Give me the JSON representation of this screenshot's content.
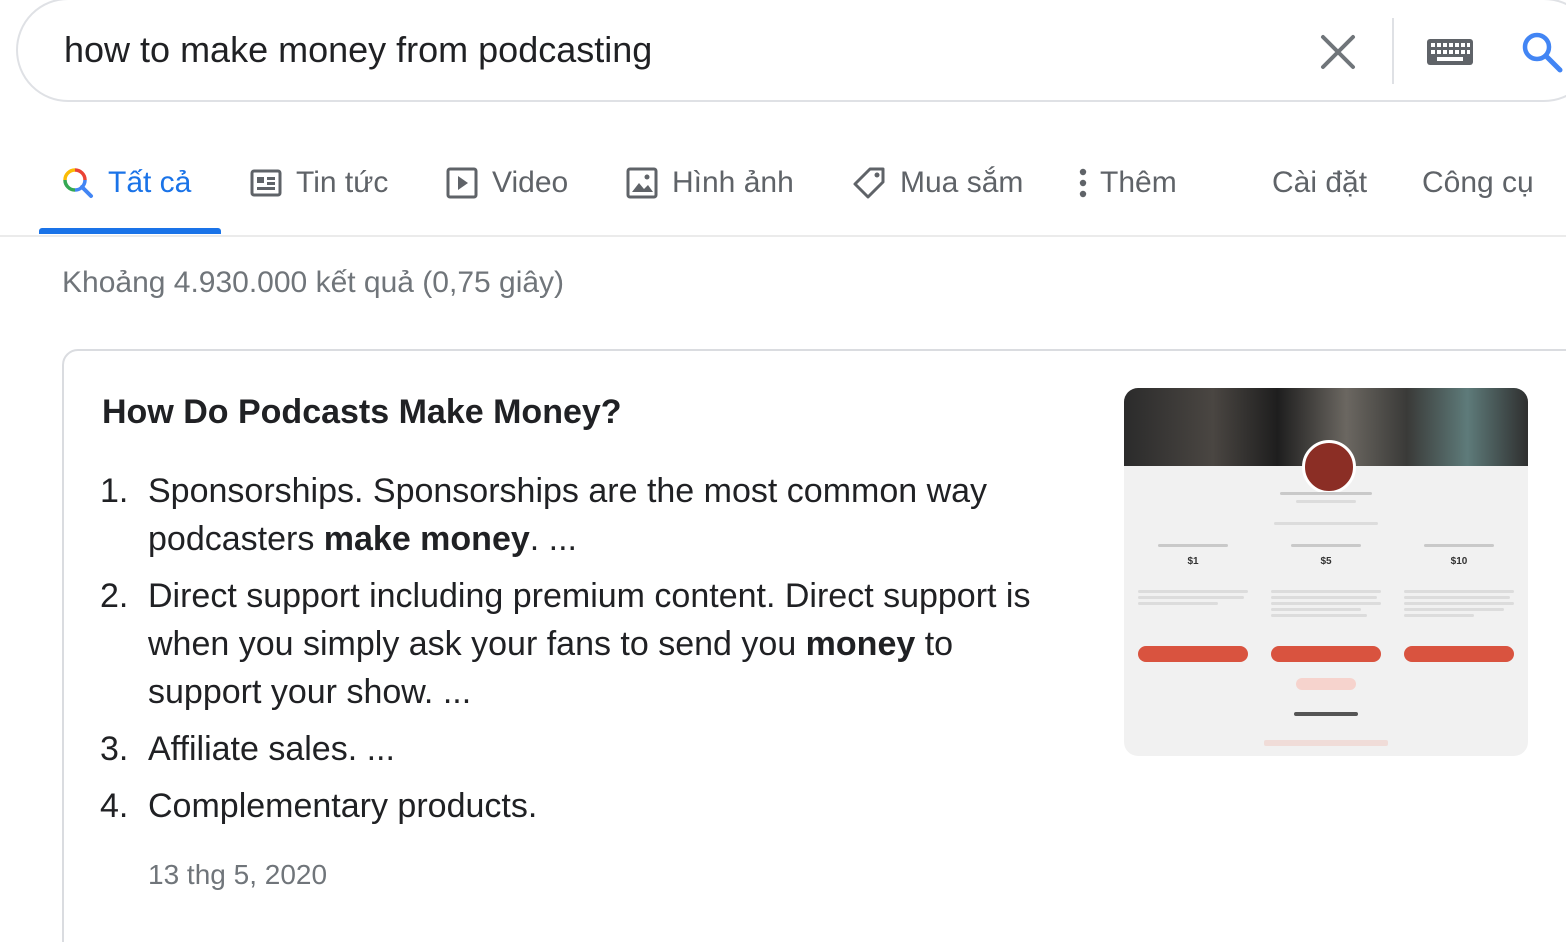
{
  "search": {
    "query": "how to make money from podcasting",
    "clear_icon": "close-icon",
    "keyboard_icon": "keyboard-icon",
    "search_icon": "search-icon"
  },
  "tabs": [
    {
      "label": "Tất cả",
      "icon": "search-icon",
      "active": true
    },
    {
      "label": "Tin tức",
      "icon": "news-icon"
    },
    {
      "label": "Video",
      "icon": "play-icon"
    },
    {
      "label": "Hình ảnh",
      "icon": "image-icon"
    },
    {
      "label": "Mua sắm",
      "icon": "tag-icon"
    },
    {
      "label": "Thêm",
      "icon": "more-vert-icon"
    }
  ],
  "tools": {
    "settings_label": "Cài đặt",
    "tools_label": "Công cụ"
  },
  "result_stats": "Khoảng 4.930.000 kết quả (0,75 giây)",
  "featured": {
    "title": "How Do Podcasts Make Money?",
    "items": [
      {
        "num": "1.",
        "before": "Sponsorships. Sponsorships are the most common way podcasters ",
        "bold": "make money",
        "after": ". ..."
      },
      {
        "num": "2.",
        "before": "Direct support including premium content. Direct support is when you simply ask your fans to send you ",
        "bold": "money",
        "after": " to support your show. ..."
      },
      {
        "num": "3.",
        "before": "Affiliate sales. ...",
        "bold": "",
        "after": ""
      },
      {
        "num": "4.",
        "before": "Complementary products.",
        "bold": "",
        "after": ""
      }
    ],
    "date": "13 thg 5, 2020",
    "thumbnail": {
      "prices": [
        "$1",
        "$5",
        "$10"
      ]
    }
  },
  "colors": {
    "accent": "#1a73e8",
    "text": "#202124",
    "muted": "#70757a",
    "tab_text": "#5f6368",
    "border": "#dfe1e5",
    "thumb_button": "#d9533f"
  }
}
